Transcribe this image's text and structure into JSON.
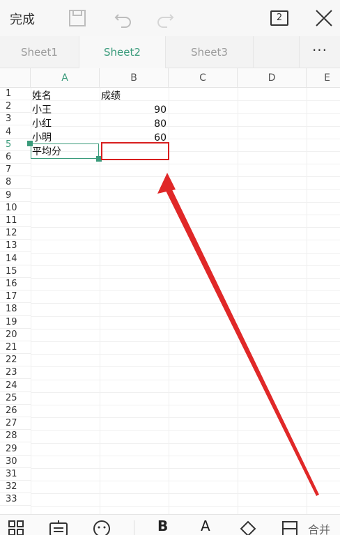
{
  "toolbar": {
    "done_label": "完成",
    "page_count": "2"
  },
  "tabs": [
    {
      "label": "Sheet1",
      "active": false
    },
    {
      "label": "Sheet2",
      "active": true
    },
    {
      "label": "Sheet3",
      "active": false
    }
  ],
  "tabs_more": "···",
  "columns": [
    "A",
    "B",
    "C",
    "D",
    "E"
  ],
  "rows": [
    "1",
    "2",
    "3",
    "4",
    "5",
    "6",
    "7",
    "8",
    "9",
    "10",
    "11",
    "12",
    "13",
    "14",
    "15",
    "16",
    "17",
    "18",
    "19",
    "20",
    "21",
    "22",
    "23",
    "24",
    "25",
    "26",
    "27",
    "28",
    "29",
    "30",
    "31",
    "32",
    "33"
  ],
  "cells": {
    "a1": "姓名",
    "b1": "成绩",
    "a2": "小王",
    "b2": "90",
    "a3": "小红",
    "b3": "80",
    "a4": "小明",
    "b4": "60",
    "a5": "平均分"
  },
  "bottom": {
    "bold_label": "B",
    "font_color_label": "A",
    "merge_label": "合并"
  },
  "colors": {
    "accent": "#3a9b7b",
    "annotation": "#d81e1e"
  }
}
